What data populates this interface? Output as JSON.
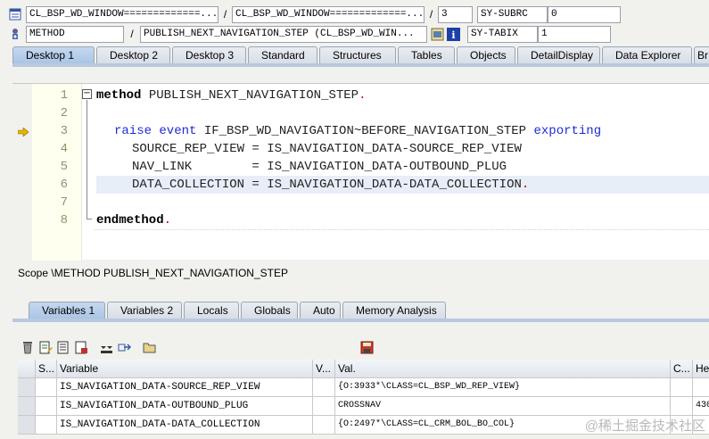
{
  "header": {
    "row1": {
      "program": "CL_BSP_WD_WINDOW=============...",
      "include": "CL_BSP_WD_WINDOW=============...",
      "line": "3",
      "sysfield_name": "SY-SUBRC",
      "sysfield_value": "0"
    },
    "row2": {
      "event_type": "METHOD",
      "event_name": "PUBLISH_NEXT_NAVIGATION_STEP (CL_BSP_WD_WIN...",
      "sysfield_name": "SY-TABIX",
      "sysfield_value": "1"
    },
    "sep": "/"
  },
  "desktop_tabs": [
    "Desktop 1",
    "Desktop 2",
    "Desktop 3",
    "Standard",
    "Structures",
    "Tables",
    "Objects",
    "DetailDisplay",
    "Data Explorer",
    "Br"
  ],
  "code": {
    "line_numbers": [
      "1",
      "2",
      "3",
      "4",
      "5",
      "6",
      "7",
      "8"
    ],
    "line1_kw": "method",
    "line1_rest": " PUBLISH_NEXT_NAVIGATION_STEP",
    "line3_kw1": "raise event",
    "line3_mid": " IF_BSP_WD_NAVIGATION~BEFORE_NAVIGATION_STEP ",
    "line3_kw2": "exporting",
    "line4": "SOURCE_REP_VIEW = IS_NAVIGATION_DATA-SOURCE_REP_VIEW",
    "line5": "NAV_LINK        = IS_NAVIGATION_DATA-OUTBOUND_PLUG",
    "line6": "DATA_COLLECTION = IS_NAVIGATION_DATA-DATA_COLLECTION",
    "line8_kw": "endmethod",
    "period": ".",
    "fold_symbol": "−"
  },
  "scope_text": "Scope \\METHOD PUBLISH_NEXT_NAVIGATION_STEP",
  "variable_tabs": [
    "Variables 1",
    "Variables 2",
    "Locals",
    "Globals",
    "Auto",
    "Memory Analysis"
  ],
  "table": {
    "headers": [
      "S...",
      "Variable",
      "V...",
      "Val.",
      "C...",
      "He"
    ],
    "rows": [
      {
        "variable": "IS_NAVIGATION_DATA-SOURCE_REP_VIEW",
        "value": "{O:3933*\\CLASS=CL_BSP_WD_REP_VIEW}",
        "hex": ""
      },
      {
        "variable": "IS_NAVIGATION_DATA-OUTBOUND_PLUG",
        "value": "CROSSNAV",
        "hex": "430"
      },
      {
        "variable": "IS_NAVIGATION_DATA-DATA_COLLECTION",
        "value": "{O:2497*\\CLASS=CL_CRM_BOL_BO_COL}",
        "hex": ""
      }
    ]
  },
  "watermark": "@稀土掘金技术社区",
  "icons": {
    "row1": "program-icon",
    "row2": "method-icon",
    "execute_marker": "current-line-arrow-icon",
    "toolbar": [
      "delete-icon",
      "change-icon",
      "details-icon",
      "save-variables-icon",
      "load-icon",
      "navigate-icon",
      "folder-icon",
      "save-icon"
    ]
  },
  "colors": {
    "keyword": "#1f2ad6",
    "active_tab": "#a9c4e4",
    "current_line_marker": "#e8b400"
  }
}
